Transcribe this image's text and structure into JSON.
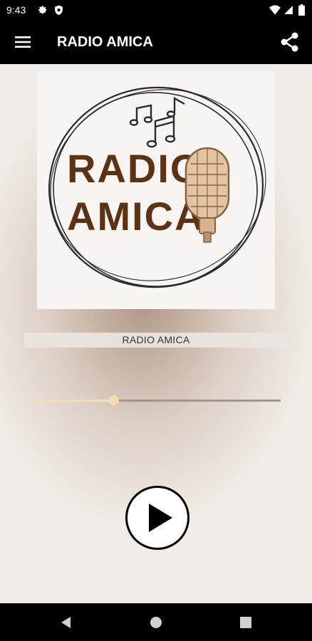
{
  "status_bar": {
    "time": "9:43"
  },
  "app_bar": {
    "title": "RADIO AMICA"
  },
  "logo": {
    "line1": "RADIO",
    "line2": "AMICA"
  },
  "station_name": "RADIO AMICA",
  "volume": {
    "level_fraction": 0.33
  },
  "player": {
    "state": "paused"
  },
  "colors": {
    "bar_background": "#000000",
    "logo_text": "#5c3217",
    "slider_accent": "#f7dcb1",
    "slider_track": "#a1968f"
  }
}
